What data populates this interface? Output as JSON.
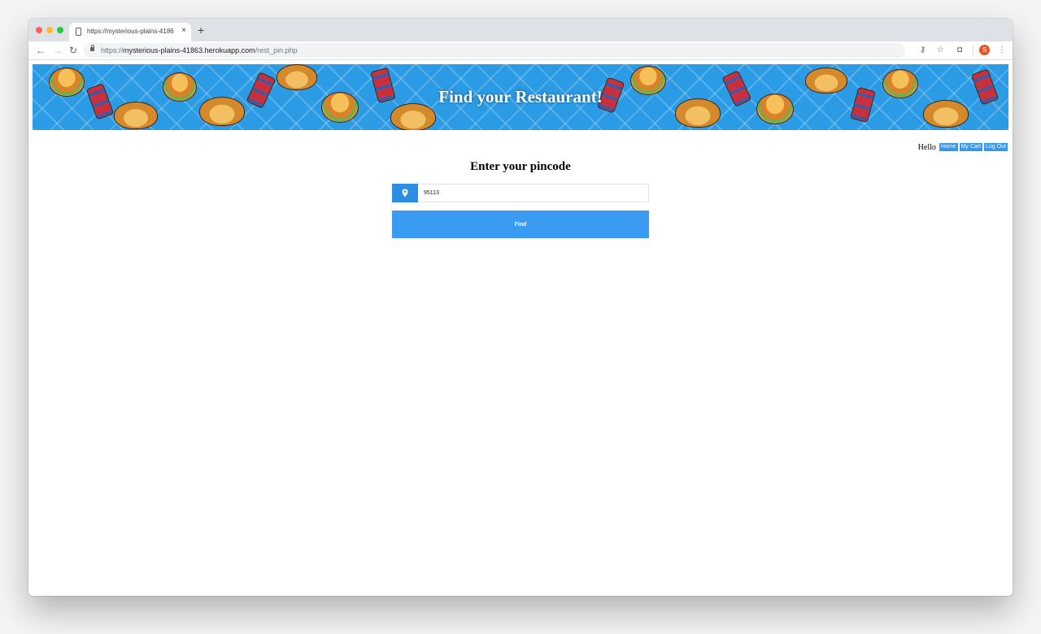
{
  "browser": {
    "tab_title": "https://mysterious-plains-4186",
    "tab_close": "×",
    "new_tab": "+",
    "url_scheme": "https://",
    "url_host": "mysterious-plains-41863.herokuapp.com",
    "url_path": "/rest_pin.php",
    "back_glyph": "←",
    "forward_glyph": "→",
    "reload_glyph": "↻",
    "key_glyph": "⚷",
    "star_glyph": "☆",
    "camera_glyph": "◘",
    "menu_glyph": "⋮",
    "avatar_initial": "S",
    "icons": [
      "back-icon",
      "forward-icon",
      "reload-icon",
      "lock-icon",
      "key-icon",
      "star-icon",
      "camera-icon",
      "profile-avatar",
      "menu-icon"
    ]
  },
  "banner": {
    "title": "Find your Restaurant!"
  },
  "user_bar": {
    "greeting": "Hello",
    "links": [
      "Home",
      "My Cart",
      "Log Out"
    ]
  },
  "form": {
    "heading": "Enter your pincode",
    "pincode_value": "95113",
    "location_icon": "map-pin-icon",
    "find_label": "Find"
  },
  "colors": {
    "accent": "#3a9bf2",
    "icon_box": "#2b8ee3",
    "banner_bg": "#2a9be4"
  }
}
